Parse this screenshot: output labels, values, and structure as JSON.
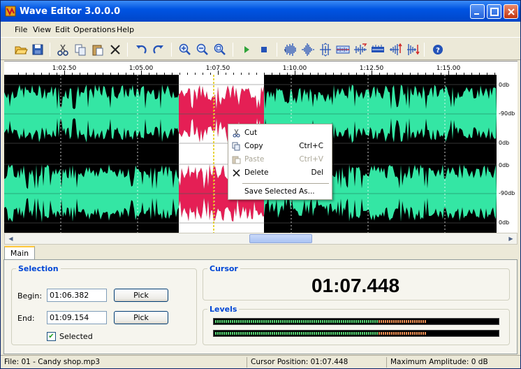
{
  "window": {
    "title": "Wave Editor 3.0.0.0",
    "buttons": [
      "minimize",
      "maximize",
      "close"
    ]
  },
  "menu": [
    "File",
    "View",
    "Edit",
    "Operations",
    "Help"
  ],
  "toolbar": {
    "groups": [
      [
        "open-icon",
        "save-icon"
      ],
      [
        "cut-icon",
        "copy-icon",
        "paste-icon",
        "delete-icon"
      ],
      [
        "undo-icon",
        "redo-icon"
      ],
      [
        "zoom-in-icon",
        "zoom-out-icon",
        "zoom-fit-icon"
      ],
      [
        "play-icon",
        "stop-icon"
      ],
      [
        "effect-normalize-icon",
        "effect-amplify-icon",
        "effect-fade-icon",
        "effect-reverse-icon",
        "effect-echo-icon",
        "effect-silence-icon",
        "effect-fade-in-icon",
        "effect-fade-out-icon"
      ],
      [
        "help-icon"
      ]
    ]
  },
  "ruler": {
    "labels": [
      "1:02.50",
      "1:05.00",
      "1:07.50",
      "1:10.00",
      "1:12.50",
      "1:15.00"
    ]
  },
  "db_scale": [
    "0db",
    "-90db",
    "0db",
    "0db",
    "-90db",
    "0db"
  ],
  "colors": {
    "waveform": "#34E6A4",
    "selection_waveform": "#E51F55",
    "selection_bg": "#FFFFFF",
    "cursor": "#E0C800"
  },
  "context_menu": {
    "items": [
      {
        "icon": "cut-icon",
        "label": "Cut",
        "shortcut": ""
      },
      {
        "icon": "copy-icon",
        "label": "Copy",
        "shortcut": "Ctrl+C"
      },
      {
        "icon": "paste-icon",
        "label": "Paste",
        "shortcut": "Ctrl+V",
        "disabled": true
      },
      {
        "icon": "delete-icon",
        "label": "Delete",
        "shortcut": "Del"
      },
      {
        "icon": "",
        "label": "Save Selected As...",
        "shortcut": ""
      }
    ]
  },
  "tabs": [
    {
      "label": "Main",
      "active": true
    }
  ],
  "selection": {
    "title": "Selection",
    "begin_label": "Begin:",
    "begin_value": "01:06.382",
    "end_label": "End:",
    "end_value": "01:09.154",
    "pick_label": "Pick",
    "selected_label": "Selected",
    "selected_checked": true
  },
  "cursor": {
    "title": "Cursor",
    "time": "01:07.448"
  },
  "levels": {
    "title": "Levels",
    "channels": [
      {
        "level": 0.75,
        "peak": 0.58
      },
      {
        "level": 0.75,
        "peak": 0.58
      }
    ]
  },
  "status": {
    "file": "File: 01 - Candy shop.mp3",
    "cursor_position": "Cursor Position: 01:07.448",
    "max_amplitude": "Maximum Amplitude: 0 dB"
  }
}
